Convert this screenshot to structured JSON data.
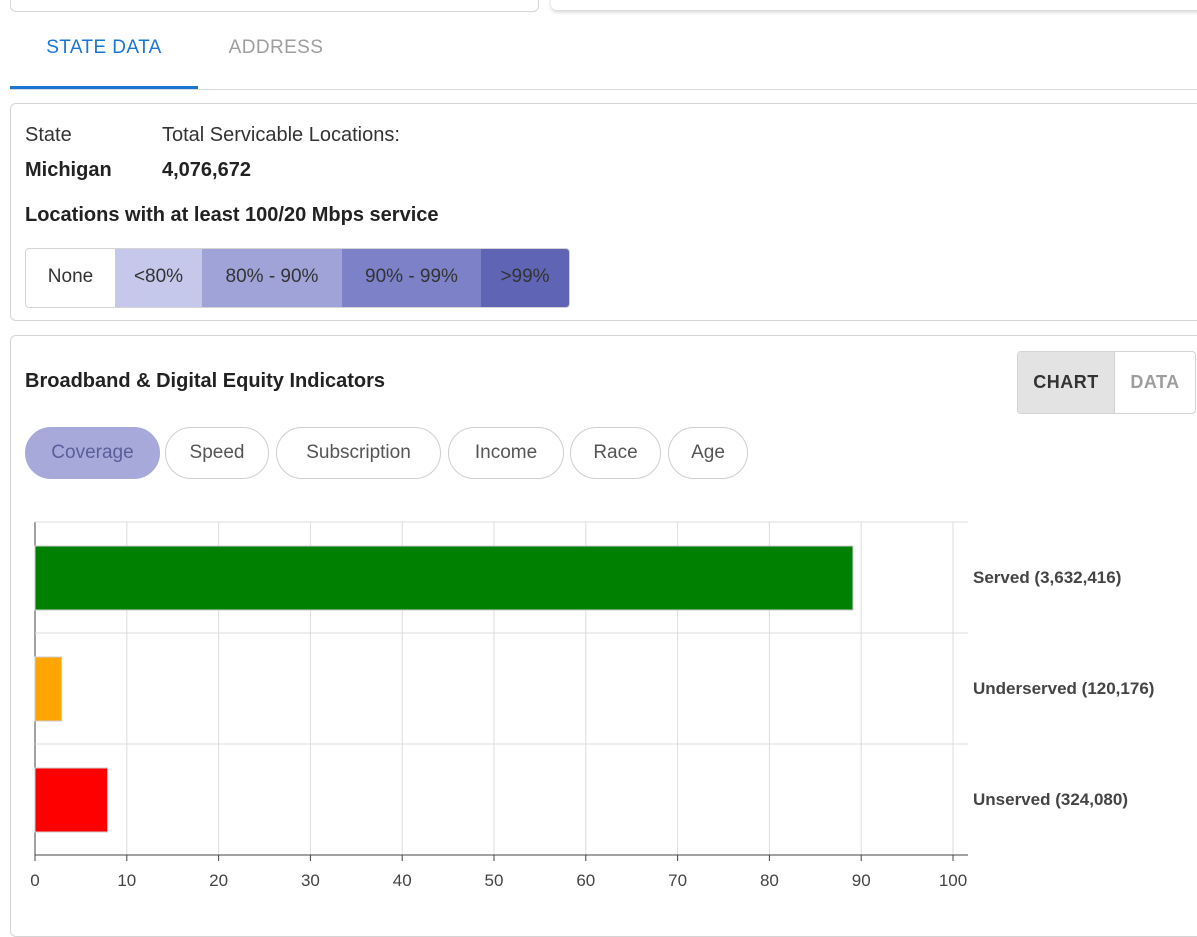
{
  "tabs": [
    {
      "label": "STATE DATA",
      "active": true
    },
    {
      "label": "ADDRESS",
      "active": false
    }
  ],
  "state_info": {
    "state_label": "State",
    "state_value": "Michigan",
    "total_label": "Total Servicable Locations:",
    "total_value": "4,076,672",
    "locations_title": "Locations with at least 100/20 Mbps service"
  },
  "legend": [
    {
      "label": "None",
      "color": "#ffffff"
    },
    {
      "label": "<80%",
      "color": "#c5c8ea"
    },
    {
      "label": "80% - 90%",
      "color": "#9fa3d8"
    },
    {
      "label": "90% - 99%",
      "color": "#7d81c8"
    },
    {
      "label": ">99%",
      "color": "#5f64b4"
    }
  ],
  "indicators": {
    "title": "Broadband & Digital Equity Indicators",
    "view_toggle": {
      "chart": "CHART",
      "data": "DATA",
      "selected": "CHART"
    },
    "chips": [
      {
        "label": "Coverage",
        "active": true
      },
      {
        "label": "Speed",
        "active": false
      },
      {
        "label": "Subscription",
        "active": false
      },
      {
        "label": "Income",
        "active": false
      },
      {
        "label": "Race",
        "active": false
      },
      {
        "label": "Age",
        "active": false
      }
    ]
  },
  "chart_data": {
    "type": "bar",
    "orientation": "horizontal",
    "categories": [
      "Served (3,632,416)",
      "Underserved (120,176)",
      "Unserved (324,080)"
    ],
    "values": [
      89.1,
      2.9,
      7.9
    ],
    "colors": [
      "#008000",
      "#ffa500",
      "#ff0000"
    ],
    "xlim": [
      0,
      100
    ],
    "xticks": [
      0,
      10,
      20,
      30,
      40,
      50,
      60,
      70,
      80,
      90,
      100
    ],
    "grid": true
  }
}
